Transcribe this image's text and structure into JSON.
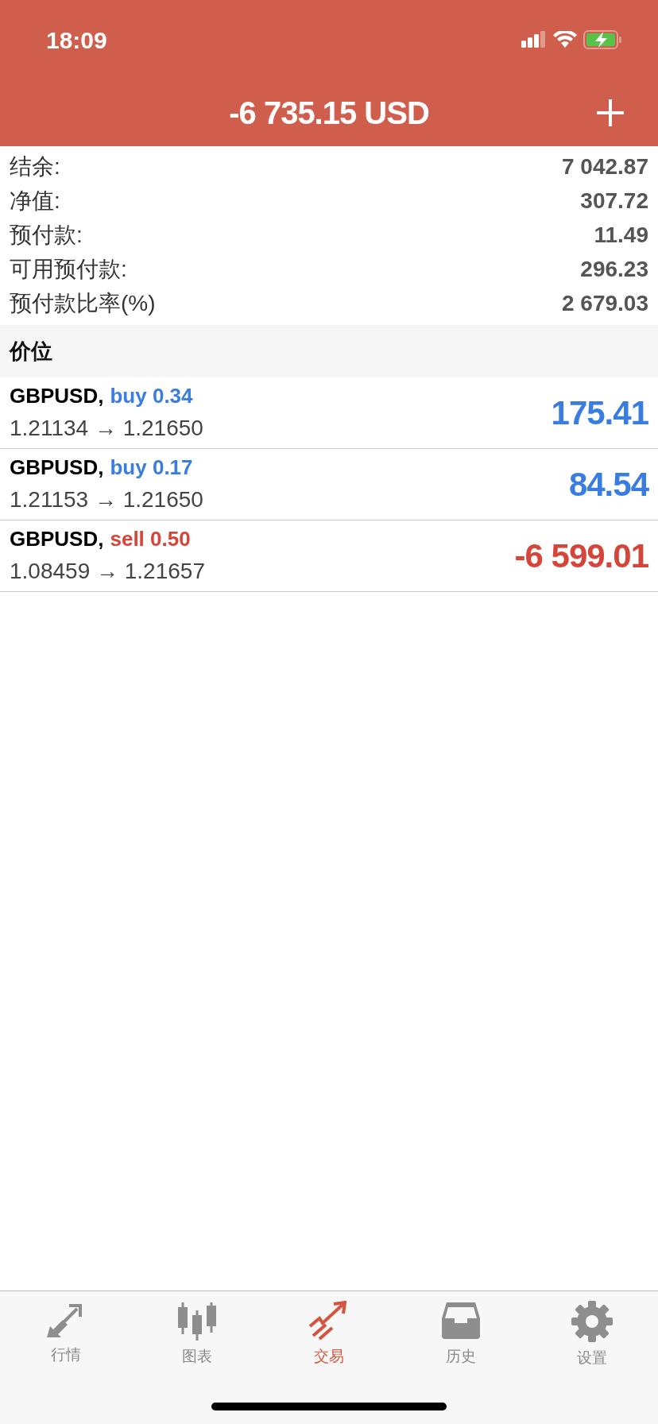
{
  "status_bar": {
    "time": "18:09"
  },
  "header": {
    "title": "-6 735.15 USD"
  },
  "summary": [
    {
      "label": "结余:",
      "value": "7 042.87"
    },
    {
      "label": "净值:",
      "value": "307.72"
    },
    {
      "label": "预付款:",
      "value": "11.49"
    },
    {
      "label": "可用预付款:",
      "value": "296.23"
    },
    {
      "label": "预付款比率(%)",
      "value": "2 679.03"
    }
  ],
  "section": {
    "title": "价位"
  },
  "positions": [
    {
      "symbol": "GBPUSD,",
      "side": "buy",
      "kind": "buy",
      "volume": "0.34",
      "prices": "1.21134 → 1.21650",
      "profit": "175.41"
    },
    {
      "symbol": "GBPUSD,",
      "side": "buy",
      "kind": "buy",
      "volume": "0.17",
      "prices": "1.21153 → 1.21650",
      "profit": "84.54"
    },
    {
      "symbol": "GBPUSD,",
      "side": "sell",
      "kind": "sell",
      "volume": "0.50",
      "prices": "1.08459 → 1.21657",
      "profit": "-6 599.01"
    }
  ],
  "tabs": [
    {
      "label": "行情",
      "kind": "quotes",
      "selected": false
    },
    {
      "label": "图表",
      "kind": "chart",
      "selected": false
    },
    {
      "label": "交易",
      "kind": "trade",
      "selected": true
    },
    {
      "label": "历史",
      "kind": "history",
      "selected": false
    },
    {
      "label": "设置",
      "kind": "settings",
      "selected": false
    }
  ]
}
